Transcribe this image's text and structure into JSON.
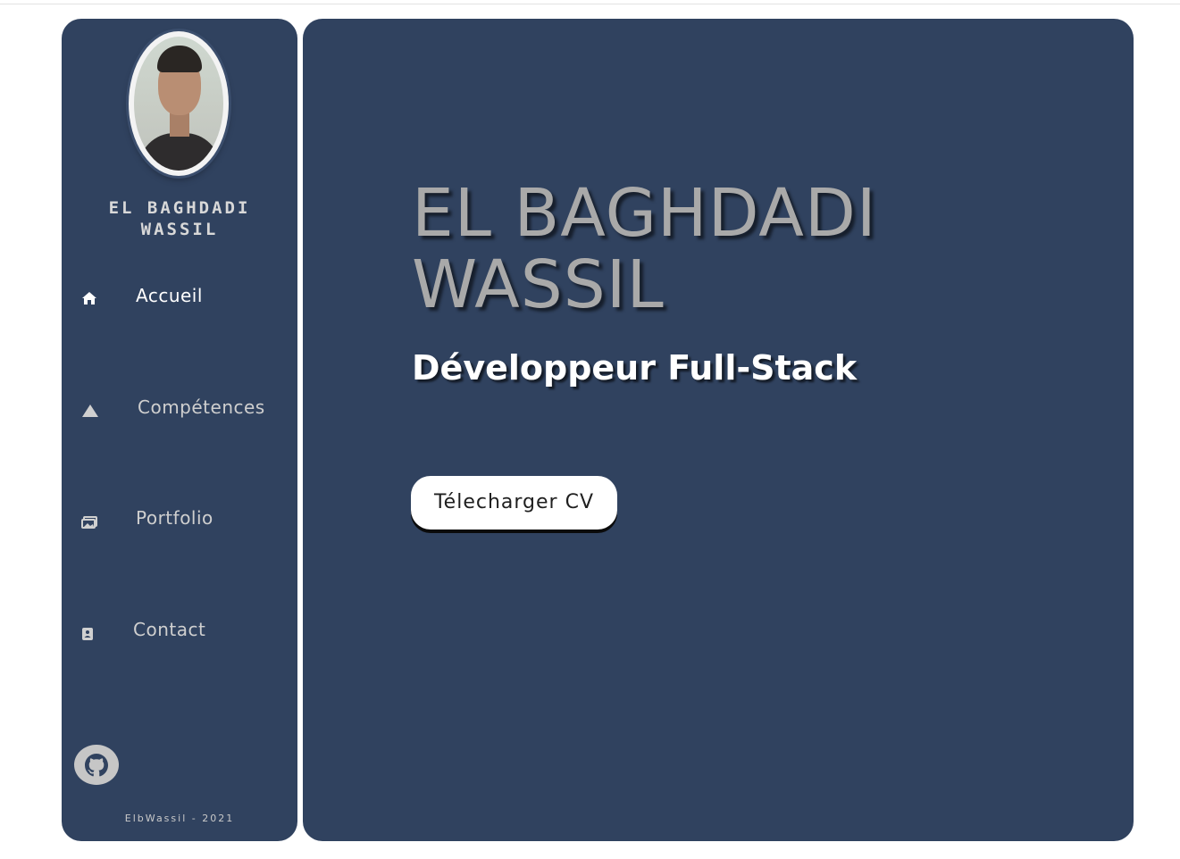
{
  "sidebar": {
    "name": "EL BAGHDADI WASSIL",
    "name_line1": "EL BAGHDADI",
    "name_line2": "WASSIL",
    "nav": [
      {
        "label": "Accueil",
        "icon": "home-icon",
        "active": true
      },
      {
        "label": "Compétences",
        "icon": "triangle-icon",
        "active": false
      },
      {
        "label": "Portfolio",
        "icon": "images-icon",
        "active": false
      },
      {
        "label": "Contact",
        "icon": "address-book-icon",
        "active": false
      }
    ],
    "social": {
      "icon": "github-icon"
    },
    "footer": "ElbWassil - 2021"
  },
  "main": {
    "hero_name_line1": "EL BAGHDADI",
    "hero_name_line2": "WASSIL",
    "subtitle": "Développeur Full-Stack",
    "cv_button": "Télecharger CV"
  },
  "colors": {
    "background": "#ffffff",
    "panel": "#30425f",
    "hero_name": "#a9a9a9",
    "subtitle": "#ffffff",
    "button_bg": "#ffffff",
    "github_bg": "#c6c6c6"
  }
}
